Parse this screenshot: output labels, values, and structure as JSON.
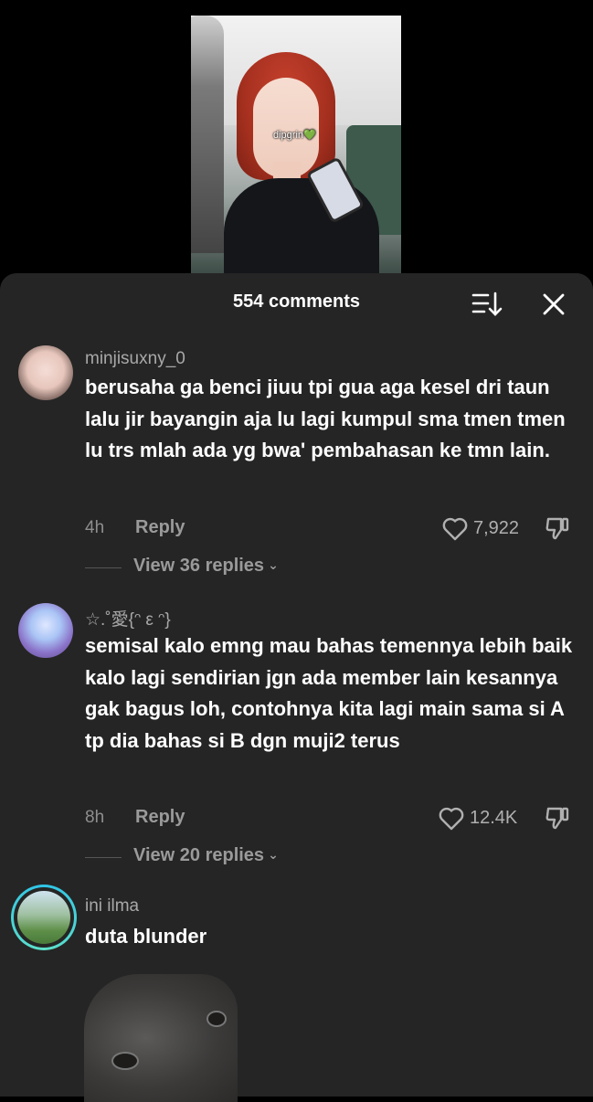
{
  "video": {
    "caption": "dipgrin💚"
  },
  "header": {
    "title": "554 comments",
    "sort_icon": "sort-icon",
    "close_icon": "close-icon"
  },
  "comments": [
    {
      "username": "minjisuxny_0",
      "text": "berusaha ga benci jiuu tpi gua aga kesel dri taun lalu jir bayangin aja lu lagi kumpul sma tmen tmen lu trs mlah ada yg bwa' pembahasan ke tmn lain.",
      "time": "4h",
      "reply_label": "Reply",
      "likes": "7,922",
      "view_replies": "View 36 replies"
    },
    {
      "username": "☆.˚愛{ᵔ ε ᵔ}",
      "text": "semisal kalo emng mau bahas temennya lebih baik kalo lagi sendirian jgn ada member lain kesannya gak bagus loh, contohnya kita lagi main sama si A tp dia bahas si B dgn muji2 terus",
      "time": "8h",
      "reply_label": "Reply",
      "likes": "12.4K",
      "view_replies": "View 20 replies"
    },
    {
      "username": "ini ilma",
      "text": "duta blunder"
    }
  ],
  "colors": {
    "sheet_bg": "#252525",
    "page_bg": "#000000",
    "story_ring": "#2ec4e8"
  }
}
